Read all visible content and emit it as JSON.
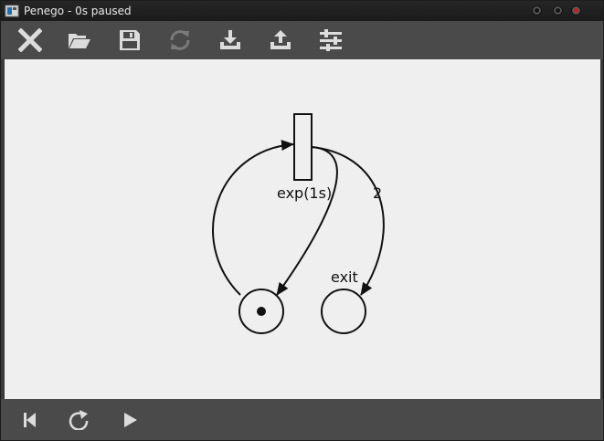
{
  "window": {
    "title": "Penego - 0s paused"
  },
  "toolbar": {
    "buttons": [
      {
        "name": "close-button",
        "icon": "close-icon",
        "enabled": true
      },
      {
        "name": "open-button",
        "icon": "folder-open-icon",
        "enabled": true
      },
      {
        "name": "save-button",
        "icon": "save-icon",
        "enabled": true
      },
      {
        "name": "reload-button",
        "icon": "reload-icon",
        "enabled": false
      },
      {
        "name": "import-button",
        "icon": "download-tray-icon",
        "enabled": true
      },
      {
        "name": "export-button",
        "icon": "upload-tray-icon",
        "enabled": true
      },
      {
        "name": "settings-button",
        "icon": "sliders-icon",
        "enabled": true
      }
    ]
  },
  "net": {
    "transition_label": "exp(1s)",
    "arc_weight_label": "2",
    "place_label": "exit"
  },
  "bottombar": {
    "buttons": [
      {
        "name": "rewind-button",
        "icon": "skip-back-icon"
      },
      {
        "name": "step-button",
        "icon": "redo-icon"
      },
      {
        "name": "play-button",
        "icon": "play-icon"
      }
    ]
  },
  "colors": {
    "toolbar_bg": "#4a4a4a",
    "canvas_bg": "#efefef",
    "icon": "#dcdcdc",
    "icon_disabled": "#7a7a7a"
  }
}
